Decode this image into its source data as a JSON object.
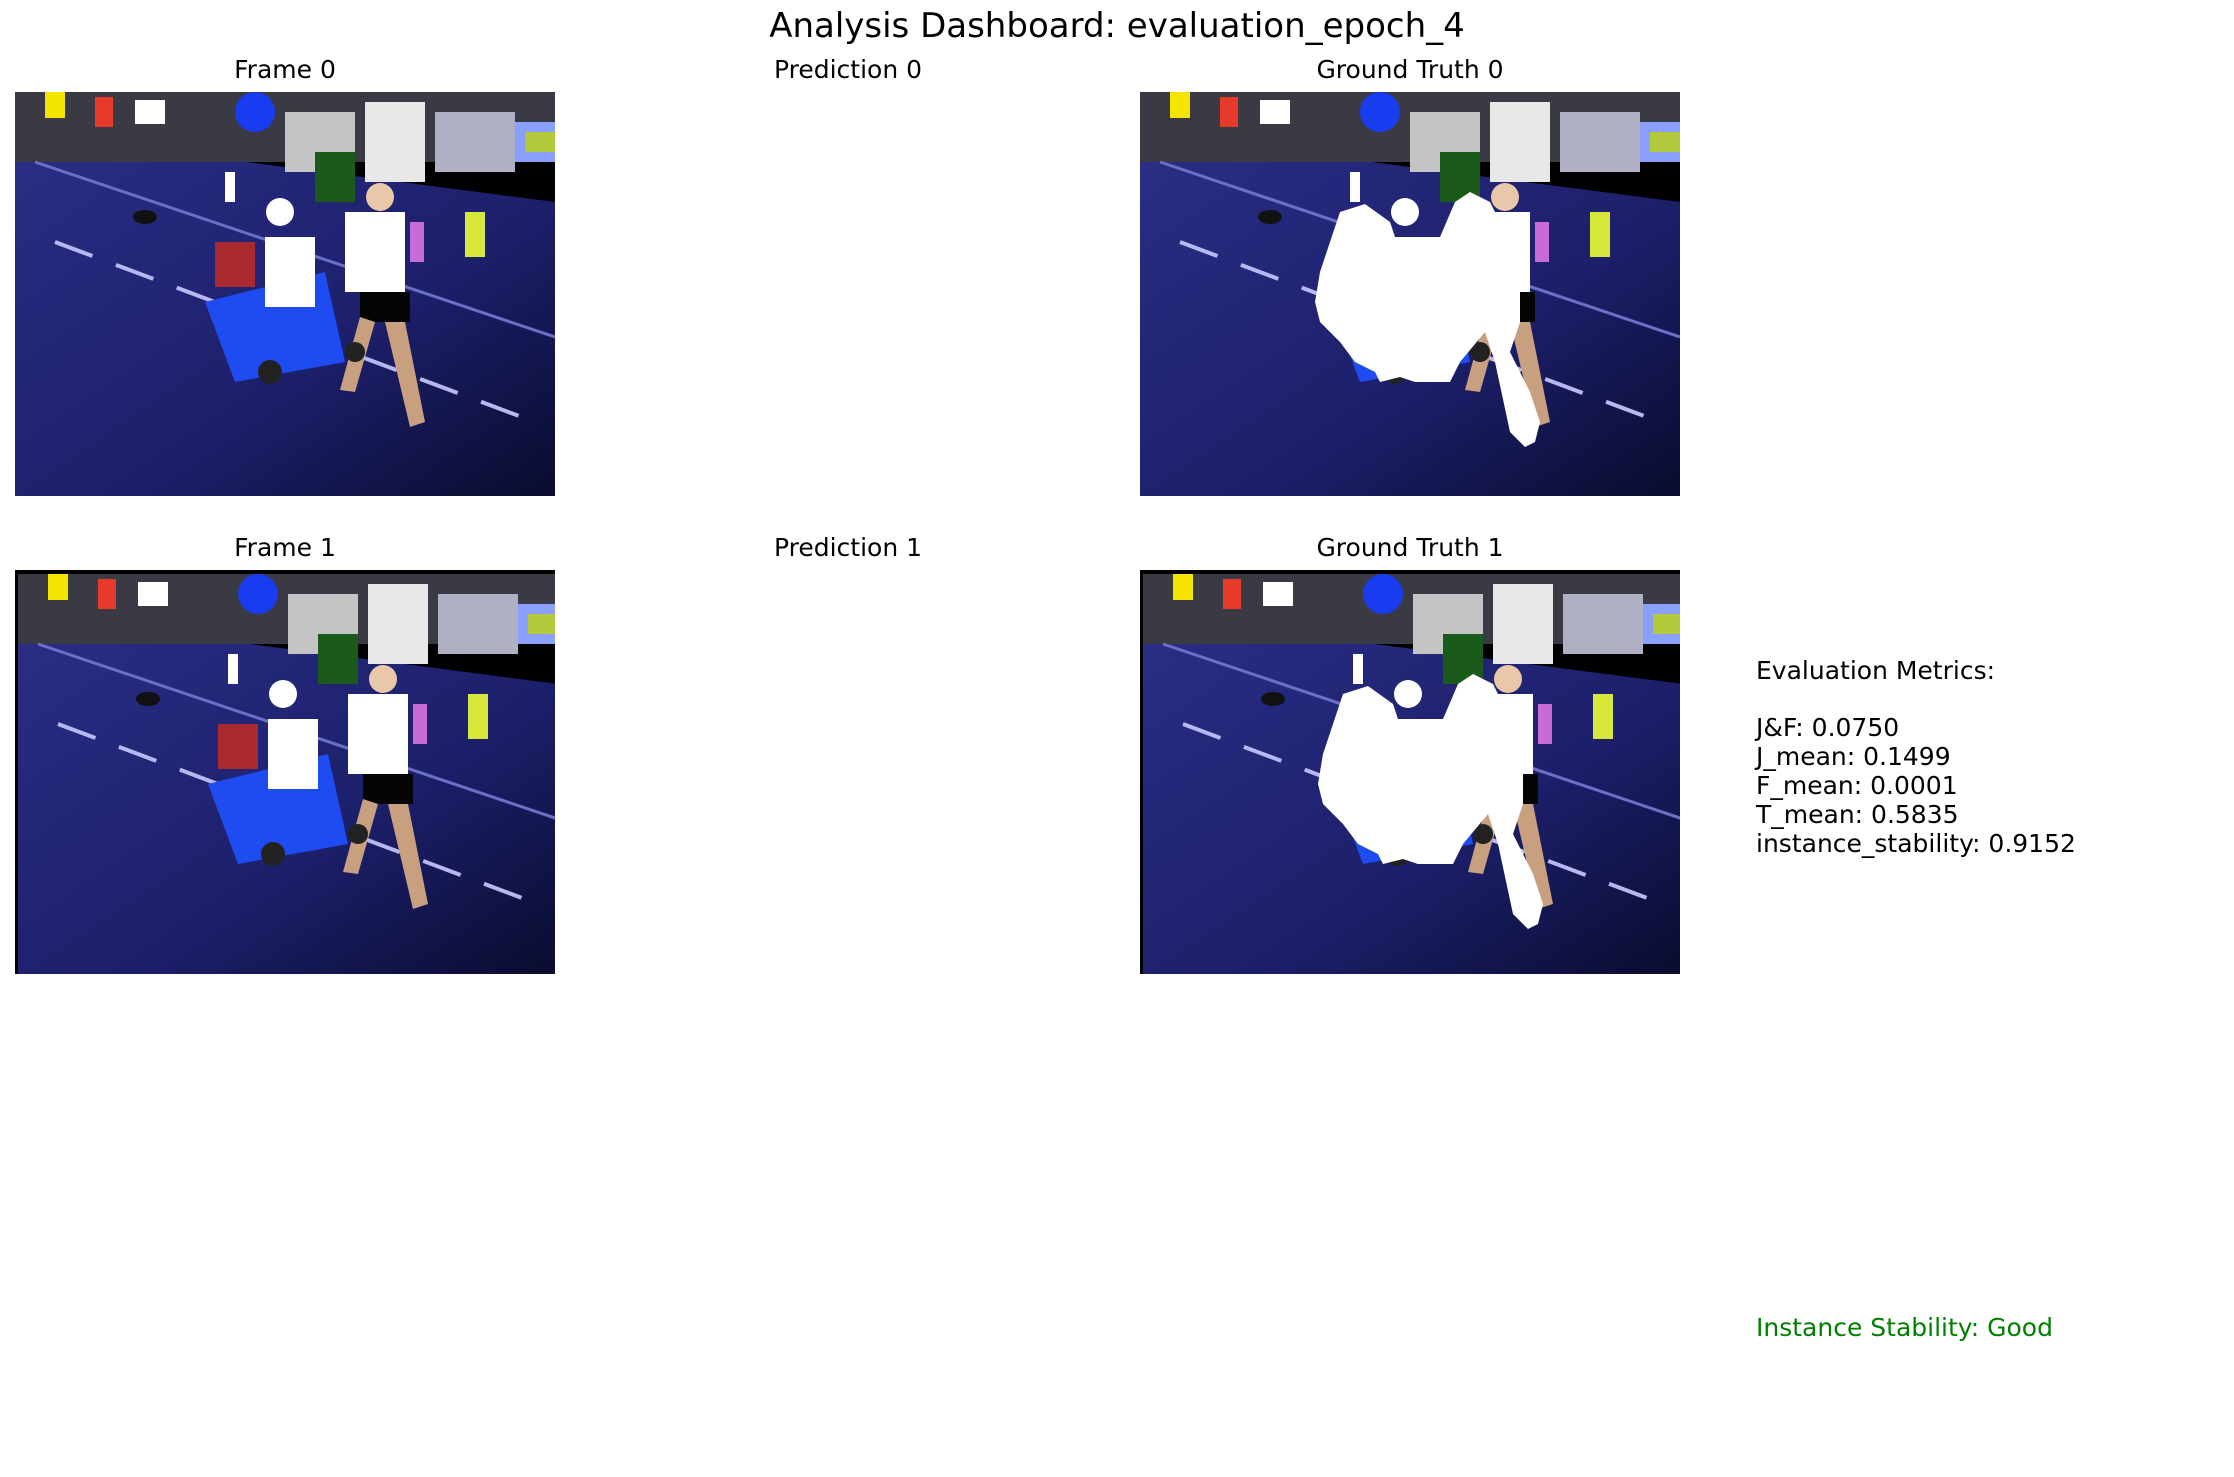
{
  "title": "Analysis Dashboard: evaluation_epoch_4",
  "rows": [
    {
      "frame_label": "Frame 0",
      "prediction_label": "Prediction 0",
      "ground_truth_label": "Ground Truth 0"
    },
    {
      "frame_label": "Frame 1",
      "prediction_label": "Prediction 1",
      "ground_truth_label": "Ground Truth 1"
    }
  ],
  "metrics": {
    "heading": "Evaluation Metrics:",
    "lines": [
      "J&F: 0.0750",
      "J_mean: 0.1499",
      "F_mean: 0.0001",
      "T_mean: 0.5835",
      "instance_stability: 0.9152"
    ]
  },
  "stability_status": "Instance Stability: Good",
  "colors": {
    "stability_good": "#008000"
  }
}
